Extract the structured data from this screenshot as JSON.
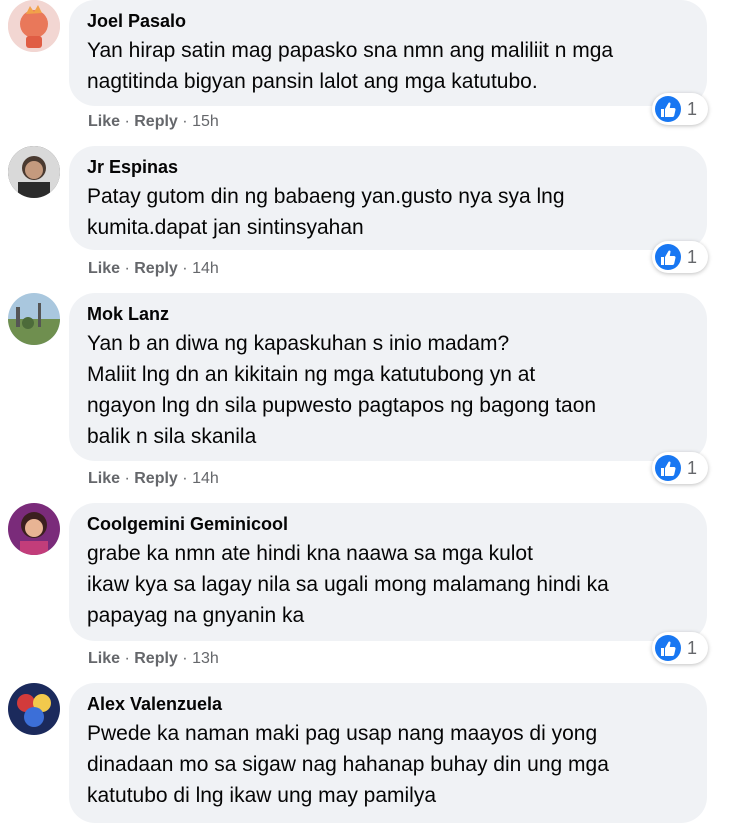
{
  "ui": {
    "like_label": "Like",
    "reply_label": "Reply",
    "separator": "·",
    "icons": {
      "like": "like-thumb-icon"
    },
    "colors": {
      "bubble": "#f0f2f5",
      "like_blue": "#1877f2",
      "meta_gray": "#65676b"
    }
  },
  "comments": [
    {
      "author": "Joel Pasalo",
      "lines": [
        "Yan hirap satin mag papasko sna nmn ang maliliit n mga",
        "nagtitinda bigyan pansin lalot ang mga katutubo."
      ],
      "time": "15h",
      "reaction_count": "1"
    },
    {
      "author": "Jr Espinas",
      "lines": [
        "Patay gutom din ng babaeng yan.gusto nya sya lng",
        "kumita.dapat jan sintinsyahan"
      ],
      "time": "14h",
      "reaction_count": "1"
    },
    {
      "author": "Mok Lanz",
      "lines": [
        "Yan b an diwa ng kapaskuhan s inio madam?",
        "Maliit lng dn an kikitain ng mga katutubong yn at",
        "ngayon lng dn sila pupwesto pagtapos ng bagong taon",
        "balik n sila skanila"
      ],
      "time": "14h",
      "reaction_count": "1"
    },
    {
      "author": "Coolgemini Geminicool",
      "lines": [
        "grabe ka nmn ate hindi kna naawa sa mga kulot",
        "ikaw kya sa lagay nila sa ugali mong malamang hindi ka",
        "papayag na gnyanin ka"
      ],
      "time": "13h",
      "reaction_count": "1"
    },
    {
      "author": "Alex Valenzuela",
      "lines": [
        "Pwede ka naman maki pag usap nang maayos di yong",
        "dinadaan mo sa sigaw nag hahanap buhay din ung mga",
        "katutubo di lng ikaw ung may pamilya"
      ]
    }
  ]
}
